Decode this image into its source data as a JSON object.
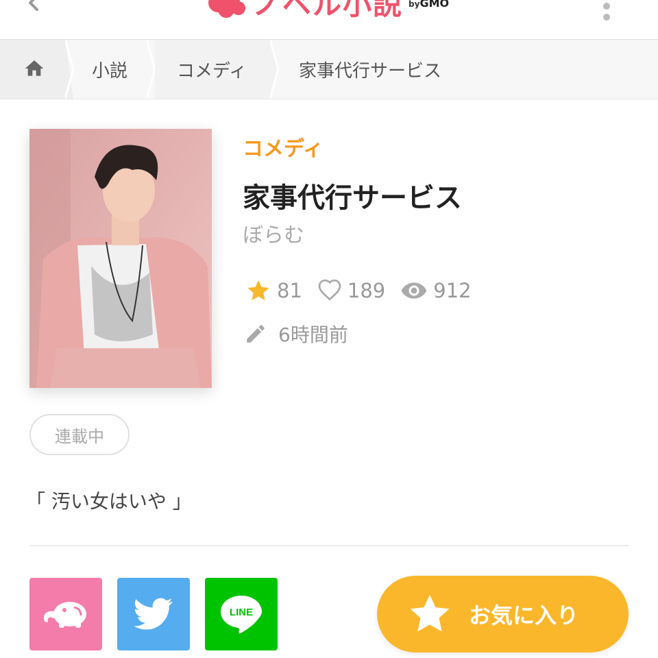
{
  "header": {
    "brand_name": "ノベル小説",
    "brand_by": "by",
    "brand_gmo": "GMO",
    "back_icon": "chevron-left-icon",
    "menu_icon": "more-vertical-icon"
  },
  "breadcrumb": {
    "home_icon": "home-icon",
    "items": [
      "小説",
      "コメディ",
      "家事代行サービス"
    ]
  },
  "novel": {
    "genre": "コメディ",
    "title": "家事代行サービス",
    "author": "ぼらむ",
    "stats": {
      "stars": "81",
      "likes": "189",
      "views": "912"
    },
    "updated": "6時間前",
    "status": "連載中",
    "catchphrase": "「 汚い女はいや 」"
  },
  "share": {
    "elephant_icon": "elephant-share-icon",
    "twitter_icon": "twitter-icon",
    "line_label": "LINE"
  },
  "favorite_label": "お気に入り",
  "colors": {
    "accent_orange": "#f7981c",
    "favorite_yellow": "#fbb72b",
    "brand_pink": "#f0526b",
    "share_pink": "#f47cab",
    "twitter_blue": "#55acee",
    "line_green": "#00c300"
  }
}
